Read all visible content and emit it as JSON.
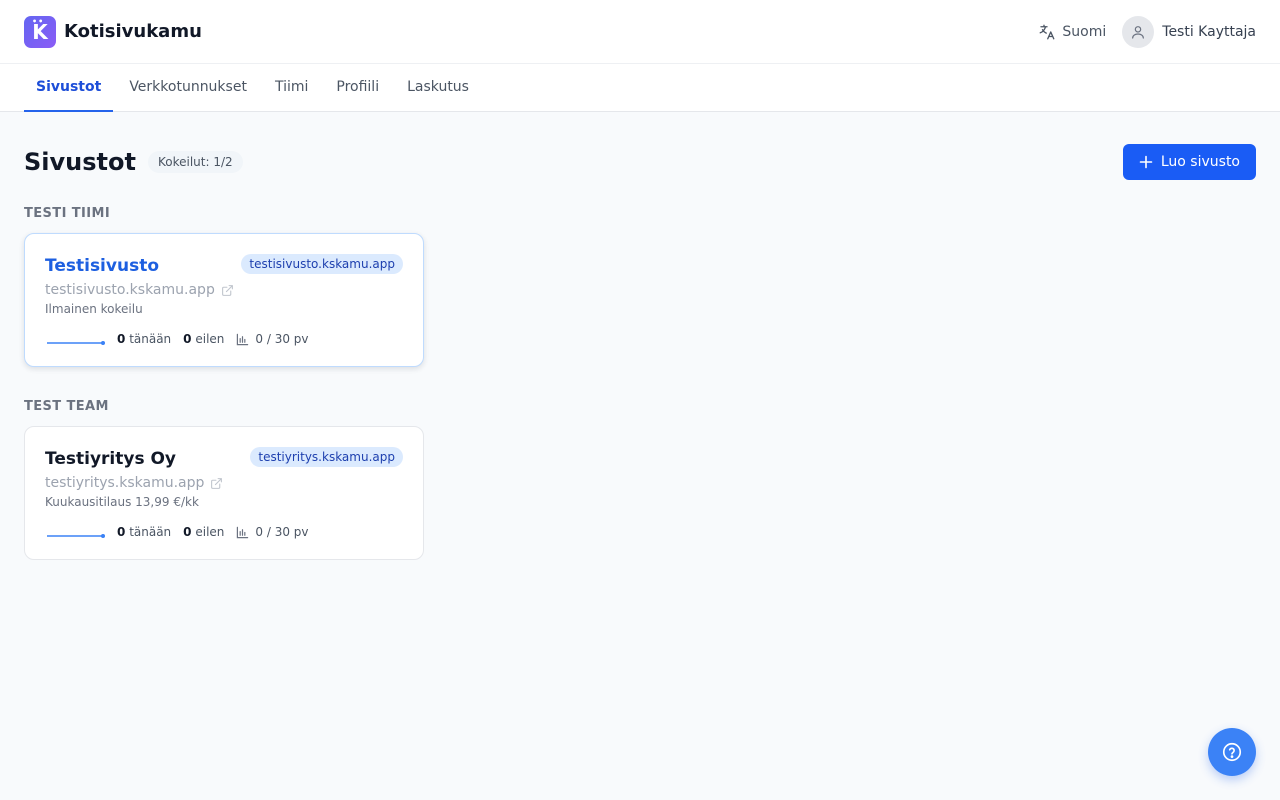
{
  "app": {
    "logo_letter": "K",
    "name": "Kotisivukamu"
  },
  "header": {
    "language": "Suomi",
    "user_name": "Testi Kayttaja"
  },
  "tabs": [
    {
      "label": "Sivustot",
      "active": true
    },
    {
      "label": "Verkkotunnukset",
      "active": false
    },
    {
      "label": "Tiimi",
      "active": false
    },
    {
      "label": "Profiili",
      "active": false
    },
    {
      "label": "Laskutus",
      "active": false
    }
  ],
  "page": {
    "title": "Sivustot",
    "trial_badge": "Kokeilut: 1/2",
    "create_button": "Luo sivusto"
  },
  "teams": [
    {
      "label": "TESTI TIIMI",
      "sites": [
        {
          "name": "Testisivusto",
          "domain_chip": "testisivusto.kskamu.app",
          "url": "testisivusto.kskamu.app",
          "plan": "Ilmainen kokeilu",
          "today_count": "0",
          "today_label": "tänään",
          "yesterday_count": "0",
          "yesterday_label": "eilen",
          "period": "0 / 30 pv"
        }
      ]
    },
    {
      "label": "TEST TEAM",
      "sites": [
        {
          "name": "Testiyritys Oy",
          "domain_chip": "testiyritys.kskamu.app",
          "url": "testiyritys.kskamu.app",
          "plan": "Kuukausitilaus 13,99 €/kk",
          "today_count": "0",
          "today_label": "tänään",
          "yesterday_count": "0",
          "yesterday_label": "eilen",
          "period": "0 / 30 pv"
        }
      ]
    }
  ],
  "colors": {
    "accent": "#1a5cf5",
    "link": "#1d5fe0",
    "chip_bg": "#dbeafe",
    "help": "#3b82f6"
  },
  "icons": {
    "language": "translate-icon",
    "user": "user-icon",
    "add": "plus-icon",
    "external": "external-link-icon",
    "chart": "bar-chart-icon",
    "help": "help-circle-icon"
  }
}
